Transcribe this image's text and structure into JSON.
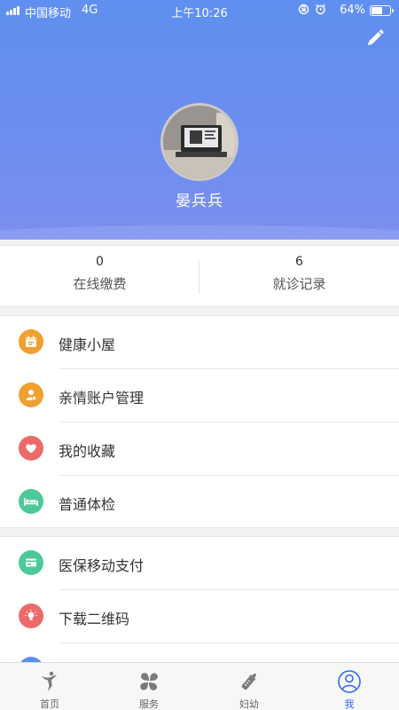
{
  "status_bar": {
    "carrier": "中国移动",
    "network": "4G",
    "time": "上午10:26",
    "battery_percent": "64%",
    "battery_level": 0.64
  },
  "profile": {
    "username": "晏兵兵",
    "edit_icon": "pencil-icon",
    "avatar_icon": "avatar-photo"
  },
  "stats": [
    {
      "value": "0",
      "label": "在线缴费"
    },
    {
      "value": "6",
      "label": "就诊记录"
    }
  ],
  "menu_group_1": [
    {
      "label": "健康小屋",
      "icon": "calendar-icon",
      "color": "#f0a030"
    },
    {
      "label": "亲情账户管理",
      "icon": "family-icon",
      "color": "#f0a030"
    },
    {
      "label": "我的收藏",
      "icon": "heart-icon",
      "color": "#ec6a6a"
    },
    {
      "label": "普通体检",
      "icon": "bed-icon",
      "color": "#4cc998"
    }
  ],
  "menu_group_2": [
    {
      "label": "医保移动支付",
      "icon": "card-icon",
      "color": "#4cc998"
    },
    {
      "label": "下载二维码",
      "icon": "lightbulb-icon",
      "color": "#ec6a6a"
    },
    {
      "label": "",
      "icon": "more-icon",
      "color": "#5b8ef0"
    }
  ],
  "tabbar": [
    {
      "label": "首页",
      "icon": "home-icon",
      "active": false
    },
    {
      "label": "服务",
      "icon": "services-icon",
      "active": false
    },
    {
      "label": "妇幼",
      "icon": "bottle-icon",
      "active": false
    },
    {
      "label": "我",
      "icon": "user-icon",
      "active": true
    }
  ],
  "colors": {
    "header_gradient_top": "#5f8ff0",
    "header_gradient_bottom": "#7b8ff0",
    "tab_active": "#2d6cf0"
  }
}
